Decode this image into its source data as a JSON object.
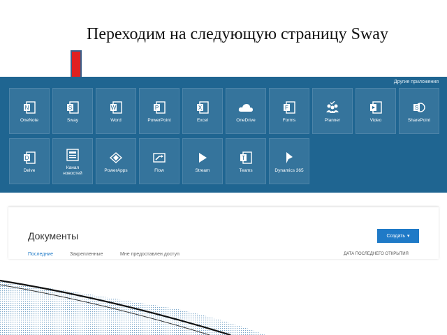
{
  "slide": {
    "title": "Переходим на следующую страницу Sway"
  },
  "launcher": {
    "more_apps": "Другие приложения",
    "apps": [
      {
        "label": "OneNote",
        "icon": "onenote-icon"
      },
      {
        "label": "Sway",
        "icon": "sway-icon"
      },
      {
        "label": "Word",
        "icon": "word-icon"
      },
      {
        "label": "PowerPoint",
        "icon": "powerpoint-icon"
      },
      {
        "label": "Excel",
        "icon": "excel-icon"
      },
      {
        "label": "OneDrive",
        "icon": "onedrive-icon"
      },
      {
        "label": "Forms",
        "icon": "forms-icon"
      },
      {
        "label": "Planner",
        "icon": "planner-icon"
      },
      {
        "label": "Video",
        "icon": "video-icon"
      },
      {
        "label": "SharePoint",
        "icon": "sharepoint-icon"
      },
      {
        "label": "Delve",
        "icon": "delve-icon"
      },
      {
        "label": "Канал\nновостей",
        "icon": "newsfeed-icon"
      },
      {
        "label": "PowerApps",
        "icon": "powerapps-icon"
      },
      {
        "label": "Flow",
        "icon": "flow-icon"
      },
      {
        "label": "Stream",
        "icon": "stream-icon"
      },
      {
        "label": "Teams",
        "icon": "teams-icon"
      },
      {
        "label": "Dynamics 365",
        "icon": "dynamics-icon"
      }
    ]
  },
  "documents": {
    "title": "Документы",
    "create_label": "Создать",
    "tabs": [
      "Последние",
      "Закрепленные",
      "Мне предоставлен доступ"
    ],
    "sort_header": "ДАТА ПОСЛЕДНЕГО ОТКРЫТИЯ"
  },
  "colors": {
    "banner": "#1f6591",
    "accent": "#1f7ac7",
    "arrow": "#e02020"
  }
}
